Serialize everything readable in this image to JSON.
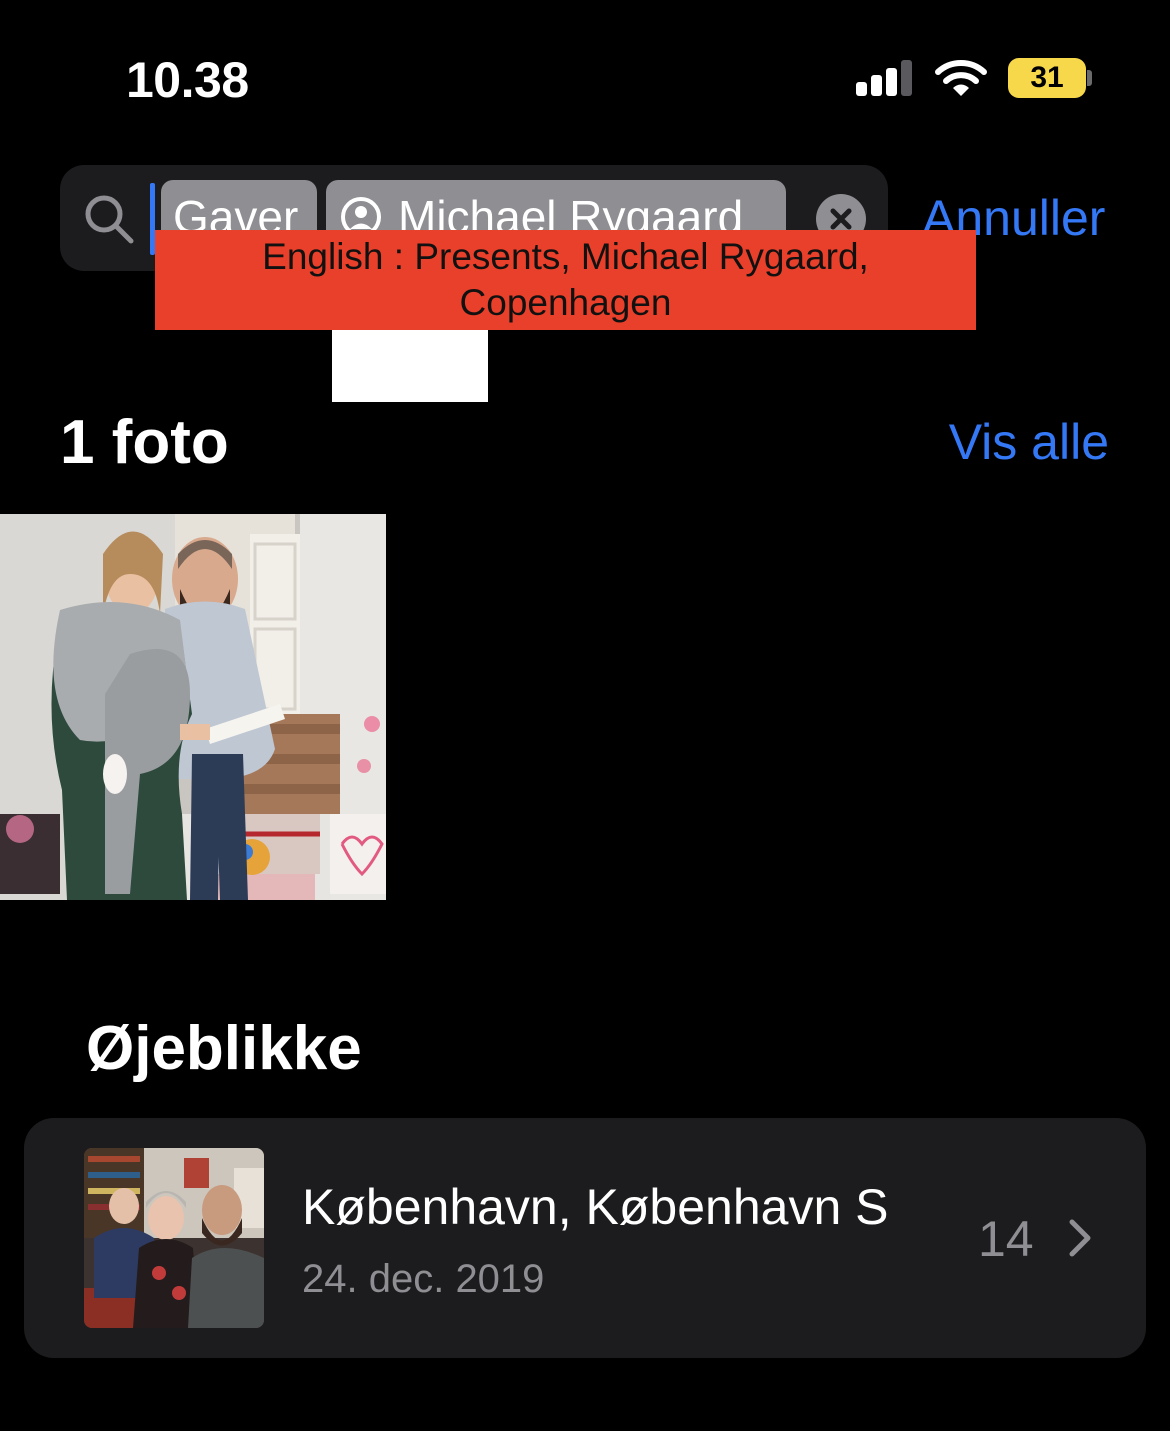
{
  "status_bar": {
    "time": "10.38",
    "battery": "31",
    "signal_bars_active": 3,
    "signal_bars_total": 4
  },
  "search": {
    "tokens": [
      "Gaver",
      "Michael Rygaard"
    ],
    "cancel_label": "Annuller",
    "icons": {
      "search": "search-icon",
      "person": "person-icon",
      "clear": "clear-icon"
    }
  },
  "overlay": {
    "translation": "English : Presents, Michael Rygaard, Copenhagen"
  },
  "photos": {
    "title": "1 foto",
    "see_all": "Vis alle"
  },
  "moments": {
    "title": "Øjeblikke",
    "items": [
      {
        "place": "København, København S",
        "date": "24. dec. 2019",
        "count": "14"
      }
    ]
  },
  "colors": {
    "accent": "#3478f6",
    "battery": "#f7d84a",
    "overlay": "#e8402a",
    "card": "#1c1c1e"
  }
}
